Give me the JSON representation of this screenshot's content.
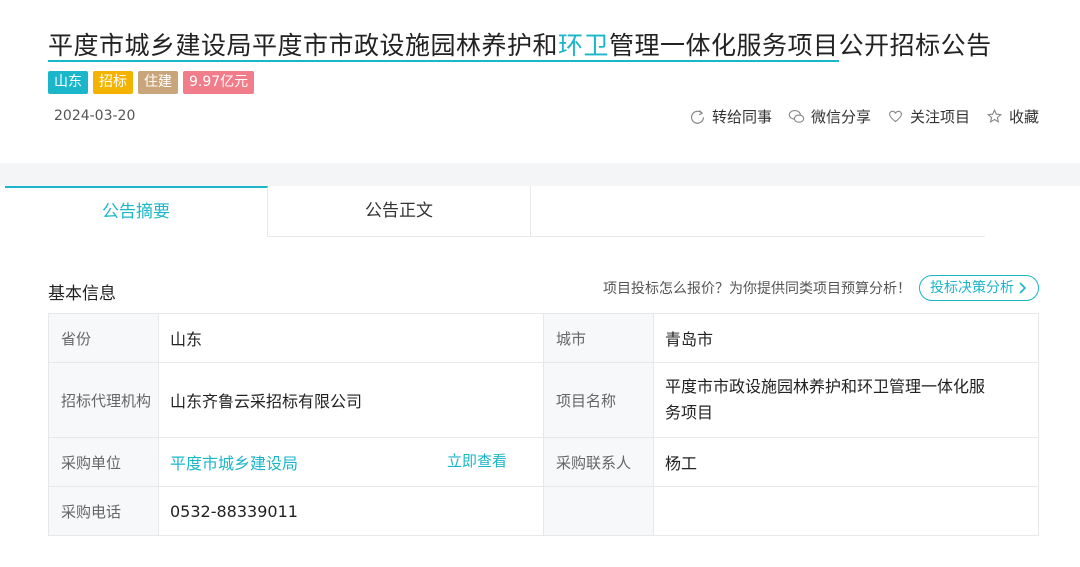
{
  "header": {
    "title_part1": "平度市城乡建设局",
    "title_part2": "平度市市政设施园林养护和",
    "title_part3": "环卫",
    "title_part4": "管理一体化服务项目",
    "title_part5": "公开招标公告",
    "tags": [
      {
        "label": "山东",
        "color": "#1bb6c9"
      },
      {
        "label": "招标",
        "color": "#f5b301"
      },
      {
        "label": "住建",
        "color": "#c8a57a"
      },
      {
        "label": "9.97亿元",
        "color": "#f17c8a"
      }
    ],
    "date": "2024-03-20",
    "actions": {
      "forward": "转给同事",
      "wechat": "微信分享",
      "follow": "关注项目",
      "favorite": "收藏"
    }
  },
  "tabs": [
    {
      "label": "公告摘要",
      "active": true
    },
    {
      "label": "公告正文",
      "active": false
    }
  ],
  "basic": {
    "title": "基本信息",
    "hint": "项目投标怎么报价？为你提供同类项目预算分析！",
    "hint_button": "投标决策分析",
    "rows": {
      "province_label": "省份",
      "province_value": "山东",
      "city_label": "城市",
      "city_value": "青岛市",
      "agency_label": "招标代理机构",
      "agency_value": "山东齐鲁云采招标有限公司",
      "project_label": "项目名称",
      "project_value": "平度市市政设施园林养护和环卫管理一体化服务项目",
      "buyer_label": "采购单位",
      "buyer_value": "平度市城乡建设局",
      "buyer_link": "立即查看",
      "contact_label": "采购联系人",
      "contact_value": "杨工",
      "phone_label": "采购电话",
      "phone_value": "0532-88339011"
    }
  }
}
